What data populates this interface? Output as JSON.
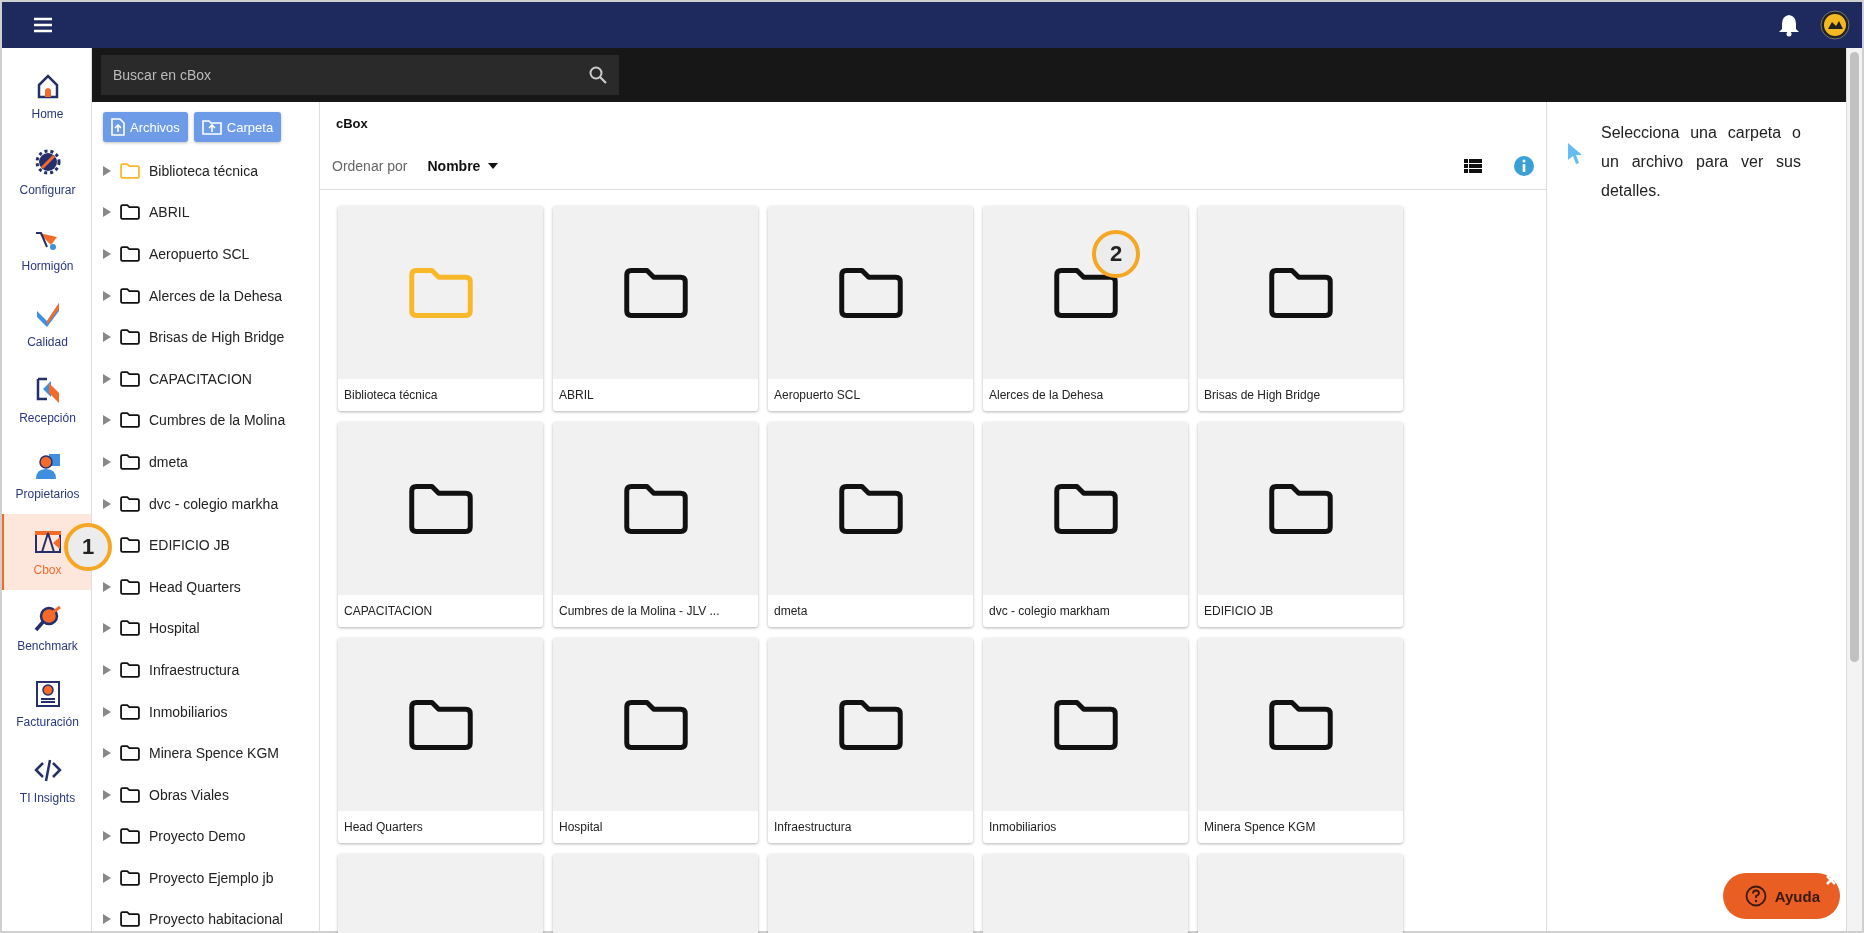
{
  "nav": [
    {
      "label": "Home",
      "kind": "home",
      "selected": false
    },
    {
      "label": "Configurar",
      "kind": "config",
      "selected": false
    },
    {
      "label": "Hormigón",
      "kind": "concrete",
      "selected": false
    },
    {
      "label": "Calidad",
      "kind": "quality",
      "selected": false
    },
    {
      "label": "Recepción",
      "kind": "reception",
      "selected": false
    },
    {
      "label": "Propietarios",
      "kind": "owners",
      "selected": false
    },
    {
      "label": "Cbox",
      "kind": "cbox",
      "selected": true
    },
    {
      "label": "Benchmark",
      "kind": "benchmark",
      "selected": false
    },
    {
      "label": "Facturación",
      "kind": "billing",
      "selected": false
    },
    {
      "label": "TI Insights",
      "kind": "code",
      "selected": false
    }
  ],
  "search": {
    "placeholder": "Buscar en cBox"
  },
  "upload_buttons": [
    "Archivos",
    "Carpeta"
  ],
  "tree": [
    {
      "label": "Biblioteca técnica",
      "kind": "library",
      "expanded": false
    },
    {
      "label": "ABRIL",
      "kind": "folder",
      "expanded": false
    },
    {
      "label": "Aeropuerto SCL",
      "kind": "folder",
      "expanded": false
    },
    {
      "label": "Alerces de la Dehesa",
      "kind": "folder",
      "expanded": false
    },
    {
      "label": "Brisas de High Bridge",
      "kind": "folder",
      "expanded": false
    },
    {
      "label": "CAPACITACION",
      "kind": "folder",
      "expanded": false
    },
    {
      "label": "Cumbres de la Molina",
      "kind": "folder",
      "expanded": false
    },
    {
      "label": "dmeta",
      "kind": "folder",
      "expanded": false
    },
    {
      "label": "dvc - colegio markha",
      "kind": "folder",
      "expanded": false
    },
    {
      "label": "EDIFICIO JB",
      "kind": "folder"
    },
    {
      "label": "Head Quarters",
      "kind": "folder",
      "expanded": false
    },
    {
      "label": "Hospital",
      "kind": "folder",
      "expanded": false
    },
    {
      "label": "Infraestructura",
      "kind": "folder",
      "expanded": false
    },
    {
      "label": "Inmobiliarios",
      "kind": "folder",
      "expanded": false
    },
    {
      "label": "Minera Spence KGM",
      "kind": "folder",
      "expanded": false
    },
    {
      "label": "Obras Viales",
      "kind": "folder",
      "expanded": false
    },
    {
      "label": "Proyecto Demo",
      "kind": "folder",
      "expanded": false
    },
    {
      "label": "Proyecto Ejemplo jb",
      "kind": "folder",
      "expanded": false
    },
    {
      "label": "Proyecto habitacional",
      "kind": "folder",
      "expanded": false
    }
  ],
  "breadcrumb": "cBox",
  "sort": {
    "label": "Ordenar por",
    "value": "Nombre"
  },
  "cards": [
    {
      "label": "Biblioteca técnica",
      "kind": "library"
    },
    {
      "label": "ABRIL",
      "kind": "folder"
    },
    {
      "label": "Aeropuerto SCL",
      "kind": "folder"
    },
    {
      "label": "Alerces de la Dehesa",
      "kind": "folder"
    },
    {
      "label": "Brisas de High Bridge",
      "kind": "folder"
    },
    {
      "label": "CAPACITACION",
      "kind": "folder"
    },
    {
      "label": "Cumbres de la Molina - JLV ...",
      "kind": "folder"
    },
    {
      "label": "dmeta",
      "kind": "folder"
    },
    {
      "label": "dvc - colegio markham",
      "kind": "folder"
    },
    {
      "label": "EDIFICIO JB",
      "kind": "folder"
    },
    {
      "label": "Head Quarters",
      "kind": "folder"
    },
    {
      "label": "Hospital",
      "kind": "folder"
    },
    {
      "label": "Infraestructura",
      "kind": "folder"
    },
    {
      "label": "Inmobiliarios",
      "kind": "folder"
    },
    {
      "label": "Minera Spence KGM",
      "kind": "folder"
    },
    {
      "kind": "partial"
    },
    {
      "kind": "partial"
    },
    {
      "kind": "partial"
    },
    {
      "kind": "partial"
    },
    {
      "kind": "partial"
    }
  ],
  "details": {
    "message": "Selecciona una carpeta o un archivo para ver sus detalles."
  },
  "help": {
    "label": "Ayuda"
  },
  "callouts": [
    "1",
    "2"
  ]
}
